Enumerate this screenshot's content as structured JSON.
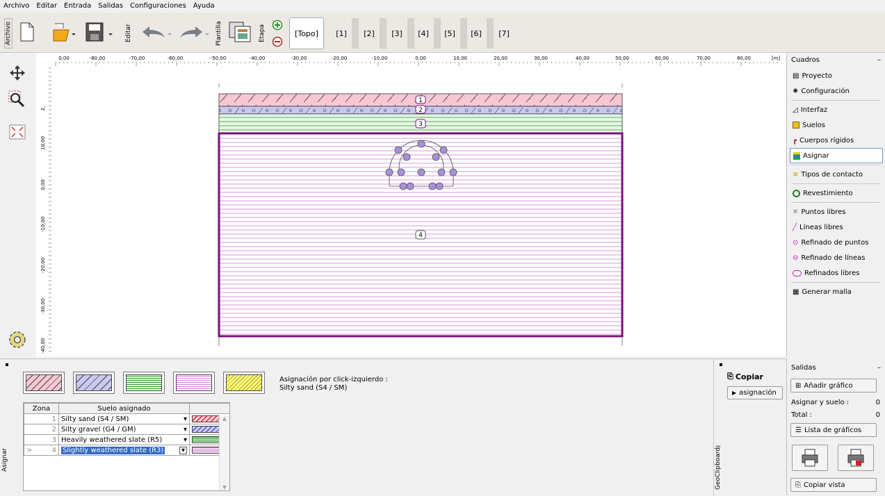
{
  "menu": [
    "Archivo",
    "Editar",
    "Entrada",
    "Salidas",
    "Configuraciones",
    "Ayuda"
  ],
  "toolbar": {
    "archivo_label": "Archivo",
    "editar_label": "Editar",
    "plantilla_label": "Plantilla",
    "etapa_label": "Etapa",
    "stages": [
      "[Topo]",
      "[1]",
      "[2]",
      "[3]",
      "[4]",
      "[5]",
      "[6]",
      "[7]"
    ]
  },
  "ruler": {
    "x_ticks": [
      "0,00",
      "-80,00",
      "-70,00",
      "-60,00",
      "-50,00",
      "-40,00",
      "-30,00",
      "-20,00",
      "-10,00",
      "0,00",
      "10,00",
      "20,00",
      "30,00",
      "40,00",
      "50,00",
      "60,00",
      "70,00",
      "80,00",
      "[m]"
    ],
    "y_ticks": [
      "2,",
      "10,00",
      "0,00",
      "-10,00",
      "-20,00",
      "-30,00",
      "-40,00"
    ]
  },
  "canvas": {
    "zone_labels": [
      "1",
      "2",
      "3",
      "4"
    ]
  },
  "right_panel": {
    "title": "Cuadros",
    "minimize": "–",
    "items": [
      {
        "label": "Proyecto",
        "icon": "document-icon"
      },
      {
        "label": "Configuración",
        "icon": "gear-icon"
      },
      {
        "label": "Interfaz",
        "icon": "interface-icon"
      },
      {
        "label": "Suelos",
        "icon": "soil-icon"
      },
      {
        "label": "Cuerpos rígidos",
        "icon": "rigid-body-icon"
      },
      {
        "label": "Asignar",
        "icon": "assign-icon"
      },
      {
        "label": "Tipos de contacto",
        "icon": "contact-icon"
      },
      {
        "label": "Revestimiento",
        "icon": "lining-icon"
      },
      {
        "label": "Puntos libres",
        "icon": "point-icon"
      },
      {
        "label": "Líneas libres",
        "icon": "line-icon"
      },
      {
        "label": "Refinado de puntos",
        "icon": "point-refine-icon"
      },
      {
        "label": "Refinado de líneas",
        "icon": "line-refine-icon"
      },
      {
        "label": "Refinados libres",
        "icon": "free-refine-icon"
      },
      {
        "label": "Generar malla",
        "icon": "mesh-icon"
      }
    ]
  },
  "assign": {
    "side_label": "Asignar",
    "info_line1": "Asignación por click-izquierdo :",
    "info_line2": "Silty sand (S4 / SM)",
    "col_zone": "Zona",
    "col_soil": "Suelo asignado",
    "rows": [
      {
        "zone": "1",
        "soil": "Silty sand (S4 / SM)"
      },
      {
        "zone": "2",
        "soil": "Silty gravel (G4 / GM)"
      },
      {
        "zone": "3",
        "soil": "Heavily weathered slate (R5)"
      },
      {
        "zone": "4",
        "soil": "Slightly weathered slate (R3)",
        "marker": ">"
      }
    ]
  },
  "geoclipboard": {
    "side_label": "GeoClipboard™",
    "copy": "Copiar",
    "assign_btn": "asignación"
  },
  "outputs": {
    "title": "Salidas",
    "minimize": "–",
    "add_graph": "Añadir gráfico",
    "assign_soil": "Asignar y suelo :",
    "assign_soil_value": "0",
    "total": "Total :",
    "total_value": "0",
    "graph_list": "Lista de gráficos",
    "copy_view": "Copiar vista"
  },
  "colors": {
    "zone1": "#f7c8d4",
    "zone2": "#c8c8f0",
    "zone3": "#c8ecc8",
    "zone4": "#f8dcf8",
    "zone5": "#ffff88",
    "selected_border": "#7a0f7a"
  }
}
